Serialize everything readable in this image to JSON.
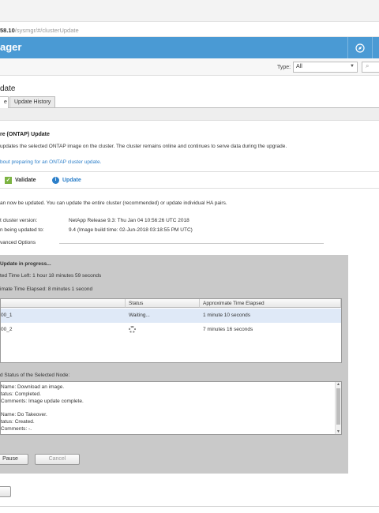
{
  "browser": {
    "url_host": "58.10",
    "url_path": "/sysmgr/#/clusterUpdate"
  },
  "header": {
    "app_title": "ager",
    "buttons": [
      {
        "icon": "compass-icon"
      },
      {
        "icon": "more-icon"
      }
    ]
  },
  "filter": {
    "type_label": "Type:",
    "type_value": "All",
    "search_glyph": "⌕"
  },
  "page": {
    "title": "date",
    "tabs": [
      {
        "label": "e",
        "active": true
      },
      {
        "label": "Update History",
        "active": false
      }
    ]
  },
  "section": {
    "title": "re (ONTAP) Update",
    "description": "updates the selected ONTAP image on the cluster. The cluster remains online and continues to serve data during the upgrade.",
    "link_text": "bout preparing for an ONTAP cluster update."
  },
  "steps": {
    "validate": "Validate",
    "update": "Update"
  },
  "status": {
    "ready_text": "an now be updated. You can update the entire cluster (recommended) or update individual HA pairs.",
    "current_version_label": "t cluster version:",
    "current_version_value": "NetApp Release 9.3: Thu Jan 04 10:56:26 UTC 2018",
    "target_version_label": "n being updated to:",
    "target_version_value": "9.4 (Image build time: 02-Jun-2018 03:18:55 PM UTC)",
    "advanced_options": "vanced Options"
  },
  "progress": {
    "title": "Update in progress...",
    "time_left": "ted Time Left:  1 hour 18 minutes 59 seconds",
    "time_elapsed": "imate Time Elapsed:  8 minutes 1 second",
    "columns": [
      "",
      "Status",
      "Approximate Time Elapsed"
    ],
    "rows": [
      {
        "node": "00_1",
        "status": "Waiting...",
        "elapsed": "1 minute 10 seconds",
        "selected": true
      },
      {
        "node": "00_2",
        "status": "",
        "elapsed": "7 minutes 16 seconds",
        "selected": false
      }
    ],
    "detail_label": "d Status of the Selected Node:",
    "detail_lines": [
      "Name: Download an image.",
      "tatus: Completed.",
      "Comments: Image update complete.",
      "",
      "Name: Do Takeover.",
      "tatus: Created.",
      "Comments: -."
    ],
    "pause_label": "Pause",
    "cancel_label": "Cancel"
  }
}
